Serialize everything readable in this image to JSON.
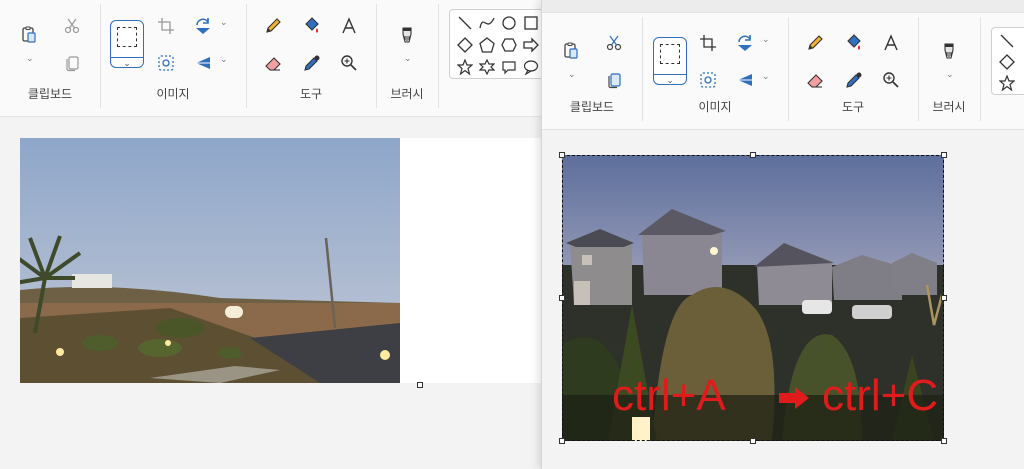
{
  "left_window": {
    "groups": {
      "clipboard": "클립보드",
      "image": "이미지",
      "tools": "도구",
      "brushes": "브러시"
    }
  },
  "right_window": {
    "groups": {
      "clipboard": "클립보드",
      "image": "이미지",
      "tools": "도구",
      "brushes": "브러시"
    },
    "annotation": {
      "left_text": "ctrl+A",
      "right_text": "ctrl+C",
      "color": "#e01b1b"
    }
  },
  "icons": [
    "paste-icon",
    "cut-icon",
    "copy-icon",
    "select-icon",
    "crop-icon",
    "rotate-icon",
    "image-select-icon",
    "flip-icon",
    "pencil-icon",
    "fill-icon",
    "text-icon",
    "eraser-icon",
    "color-picker-icon",
    "magnifier-icon",
    "brush-icon",
    "line-icon",
    "curve-icon",
    "oval-icon",
    "rectangle-icon",
    "diamond-icon",
    "pentagon-icon",
    "hexagon-icon",
    "arrow-icon",
    "star-icon",
    "six-point-star-icon",
    "speech-bubble-icon"
  ],
  "colors": {
    "ribbon_bg": "#fafafa",
    "canvas_bg": "#f3f3f3",
    "select_accent": "#2f6fbf",
    "annotation_red": "#e01b1b"
  }
}
